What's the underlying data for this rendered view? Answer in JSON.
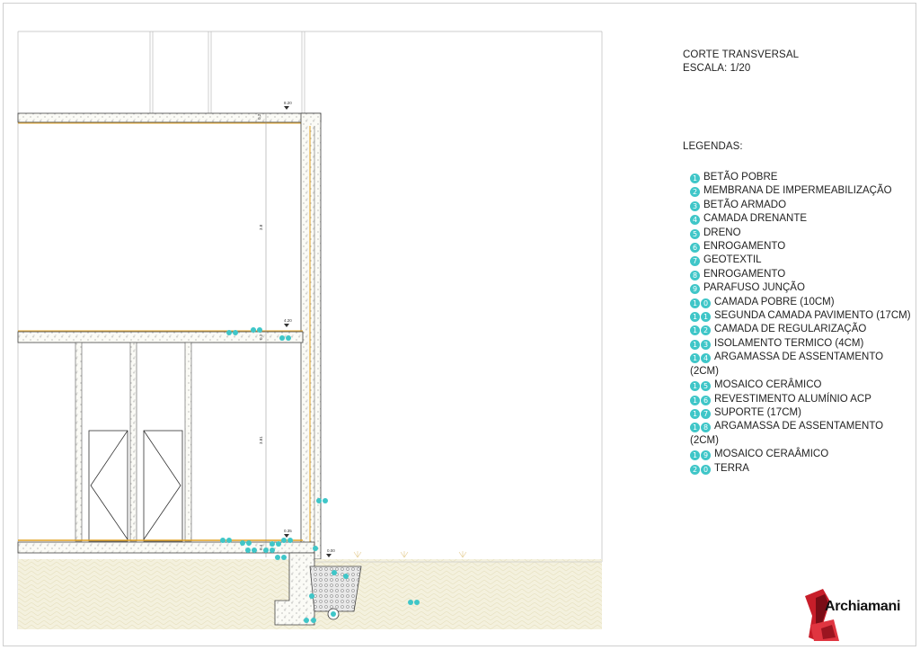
{
  "title": {
    "line1": "CORTE TRANSVERSAL",
    "line2": "ESCALA: 1/20"
  },
  "legend_heading": "LEGENDAS:",
  "legend_items": [
    {
      "num": "1",
      "text": "BETÃO POBRE"
    },
    {
      "num": "2",
      "text": "MEMBRANA DE IMPERMEABILIZAÇÃO"
    },
    {
      "num": "3",
      "text": "BETÃO ARMADO"
    },
    {
      "num": "4",
      "text": "CAMADA DRENANTE"
    },
    {
      "num": "5",
      "text": "DRENO"
    },
    {
      "num": "6",
      "text": "ENROGAMENTO"
    },
    {
      "num": "7",
      "text": "GEOTEXTIL"
    },
    {
      "num": "8",
      "text": "ENROGAMENTO"
    },
    {
      "num": "9",
      "text": "PARAFUSO JUNÇÃO"
    },
    {
      "num": "10",
      "text": "CAMADA POBRE (10CM)"
    },
    {
      "num": "11",
      "text": "SEGUNDA CAMADA PAVIMENTO (17CM)"
    },
    {
      "num": "12",
      "text": "CAMADA DE REGULARIZAÇÃO"
    },
    {
      "num": "13",
      "text": "ISOLAMENTO TERMICO (4CM)"
    },
    {
      "num": "14",
      "text": "ARGAMASSA DE ASSENTAMENTO (2CM)"
    },
    {
      "num": "15",
      "text": "MOSAICO CERÂMICO"
    },
    {
      "num": "16",
      "text": "REVESTIMENTO ALUMÍNIO ACP"
    },
    {
      "num": "17",
      "text": "SUPORTE (17CM)"
    },
    {
      "num": "18",
      "text": "ARGAMASSA DE ASSENTAMENTO (2CM)"
    },
    {
      "num": "19",
      "text": "MOSAICO CERAÂMICO"
    },
    {
      "num": "20",
      "text": "TERRA"
    }
  ],
  "drawing": {
    "level_top": "8.20",
    "level_mid": "4.20",
    "level_ground": "0.35",
    "level_ext": "0.00",
    "dim_slab_top": "0.2",
    "dim_floor_upper": "3.8",
    "dim_slab_mid": "0.2",
    "dim_floor_lower": "3.81",
    "dim_base": "0.4"
  },
  "logo_text": "Archiamani",
  "colors": {
    "accent": "#3fc6c8",
    "membrane": "#e0a020",
    "ground": "#f3f0dc",
    "line": "#555555"
  }
}
